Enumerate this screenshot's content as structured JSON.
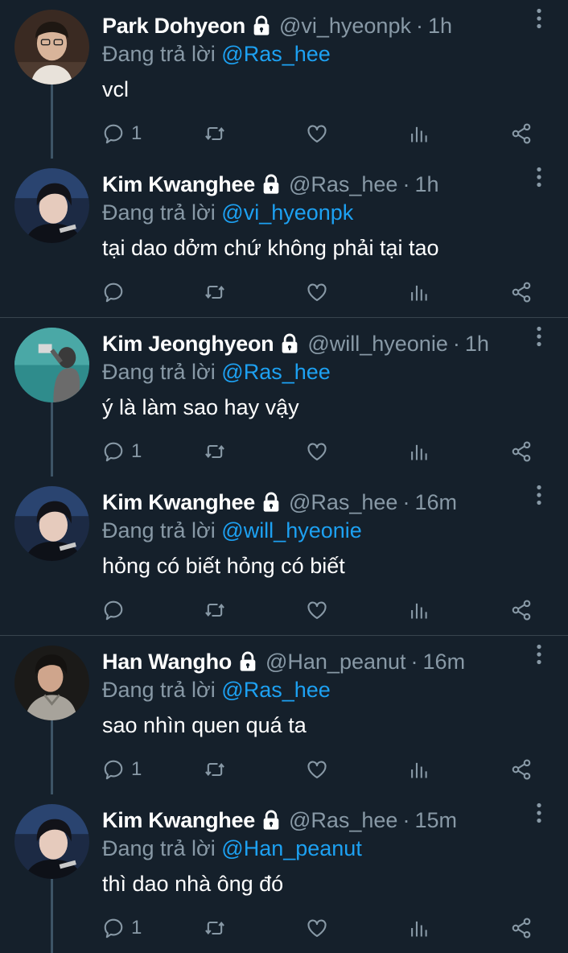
{
  "reply_prefix": "Đang trả lời",
  "tweets": [
    {
      "name": "Park Dohyeon",
      "handle": "@vi_hyeonpk",
      "time": "1h",
      "reply_to": "@Ras_hee",
      "text": "vcl",
      "reply_count": "1",
      "avatar": "avatar-park-dohyeon"
    },
    {
      "name": "Kim Kwanghee",
      "handle": "@Ras_hee",
      "time": "1h",
      "reply_to": "@vi_hyeonpk",
      "text": "tại dao dởm chứ không phải tại tao",
      "reply_count": "",
      "avatar": "avatar-kim-kwanghee"
    },
    {
      "name": "Kim Jeonghyeon",
      "handle": "@will_hyeonie",
      "time": "1h",
      "reply_to": "@Ras_hee",
      "text": "ý là làm sao hay vậy",
      "reply_count": "1",
      "avatar": "avatar-kim-jeonghyeon"
    },
    {
      "name": "Kim Kwanghee",
      "handle": "@Ras_hee",
      "time": "16m",
      "reply_to": "@will_hyeonie",
      "text": "hỏng có biết hỏng có biết",
      "reply_count": "",
      "avatar": "avatar-kim-kwanghee"
    },
    {
      "name": "Han Wangho",
      "handle": "@Han_peanut",
      "time": "16m",
      "reply_to": "@Ras_hee",
      "text": "sao nhìn quen quá ta",
      "reply_count": "1",
      "avatar": "avatar-han-wangho"
    },
    {
      "name": "Kim Kwanghee",
      "handle": "@Ras_hee",
      "time": "15m",
      "reply_to": "@Han_peanut",
      "text": "thì dao nhà ông đó",
      "reply_count": "1",
      "avatar": "avatar-kim-kwanghee"
    }
  ],
  "colors": {
    "background": "#15202b",
    "muted": "#8899a6",
    "link": "#1da1f2",
    "divider": "#38444d"
  }
}
